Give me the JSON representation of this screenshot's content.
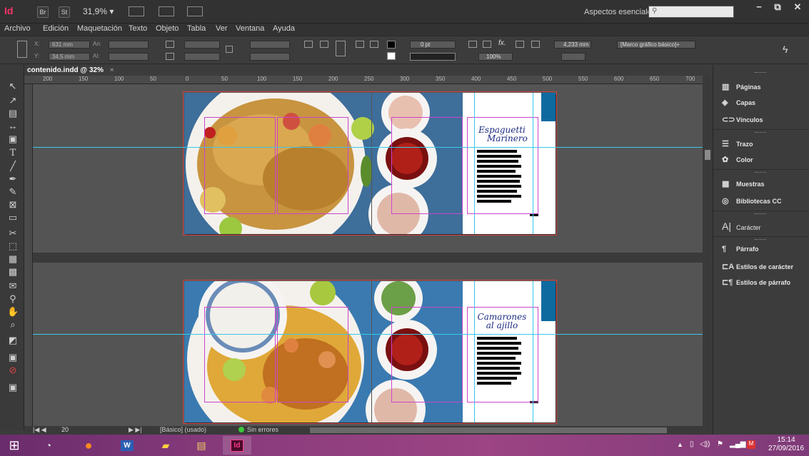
{
  "titlebar": {
    "app_logo": "Id",
    "bridge_label": "Br",
    "stock_label": "St",
    "zoom": "31,9% ▾",
    "workspace": "Aspectos esenciales ▾",
    "win_min": "−",
    "win_restore": "⧉",
    "win_close": "✕"
  },
  "menubar": [
    "Archivo",
    "Edición",
    "Maquetación",
    "Texto",
    "Objeto",
    "Tabla",
    "Ver",
    "Ventana",
    "Ayuda"
  ],
  "control": {
    "x_label": "X:",
    "x_value": "631 mm",
    "y_label": "Y:",
    "y_value": "34,5 mm",
    "w_label": "An:",
    "h_label": "Al:",
    "stroke_weight": "0 pt",
    "scale": "100%",
    "gap_value": "4,233 mm",
    "frame_style": "[Marco gráfico básico]+"
  },
  "document": {
    "tab_label": "contenido.indd @ 32%",
    "tab_close": "×"
  },
  "ruler": [
    "200",
    "150",
    "100",
    "50",
    "0",
    "50",
    "100",
    "150",
    "200",
    "250",
    "300",
    "350",
    "400",
    "450",
    "500",
    "550",
    "600",
    "650",
    "700"
  ],
  "spreads": [
    {
      "title_line1": "Espaguetti",
      "title_line2": "Marinero"
    },
    {
      "title_line1": "Camarones",
      "title_line2": "al ajillo"
    }
  ],
  "statusbar": {
    "page": "20",
    "master": "[Básico] (usado)",
    "preflight": "Sin errores"
  },
  "panels": [
    {
      "label": "Páginas",
      "icon": "pages-icon"
    },
    {
      "label": "Capas",
      "icon": "layers-icon"
    },
    {
      "label": "Vínculos",
      "icon": "links-icon"
    },
    {
      "label": "Trazo",
      "icon": "stroke-icon"
    },
    {
      "label": "Color",
      "icon": "color-icon"
    },
    {
      "label": "Muestras",
      "icon": "swatches-icon"
    },
    {
      "label": "Bibliotecas CC",
      "icon": "cc-libraries-icon"
    },
    {
      "label": "Carácter",
      "icon": "character-icon"
    },
    {
      "label": "Párrafo",
      "icon": "paragraph-icon"
    },
    {
      "label": "Estilos de carácter",
      "icon": "character-styles-icon"
    },
    {
      "label": "Estilos de párrafo",
      "icon": "paragraph-styles-icon"
    }
  ],
  "taskbar": {
    "time": "15:14",
    "date": "27/09/2016"
  },
  "colors": {
    "accent_id": "#ff3366",
    "guide": "#38c8e8",
    "frame": "#cc44cc",
    "title_blue": "#1c2a80"
  }
}
